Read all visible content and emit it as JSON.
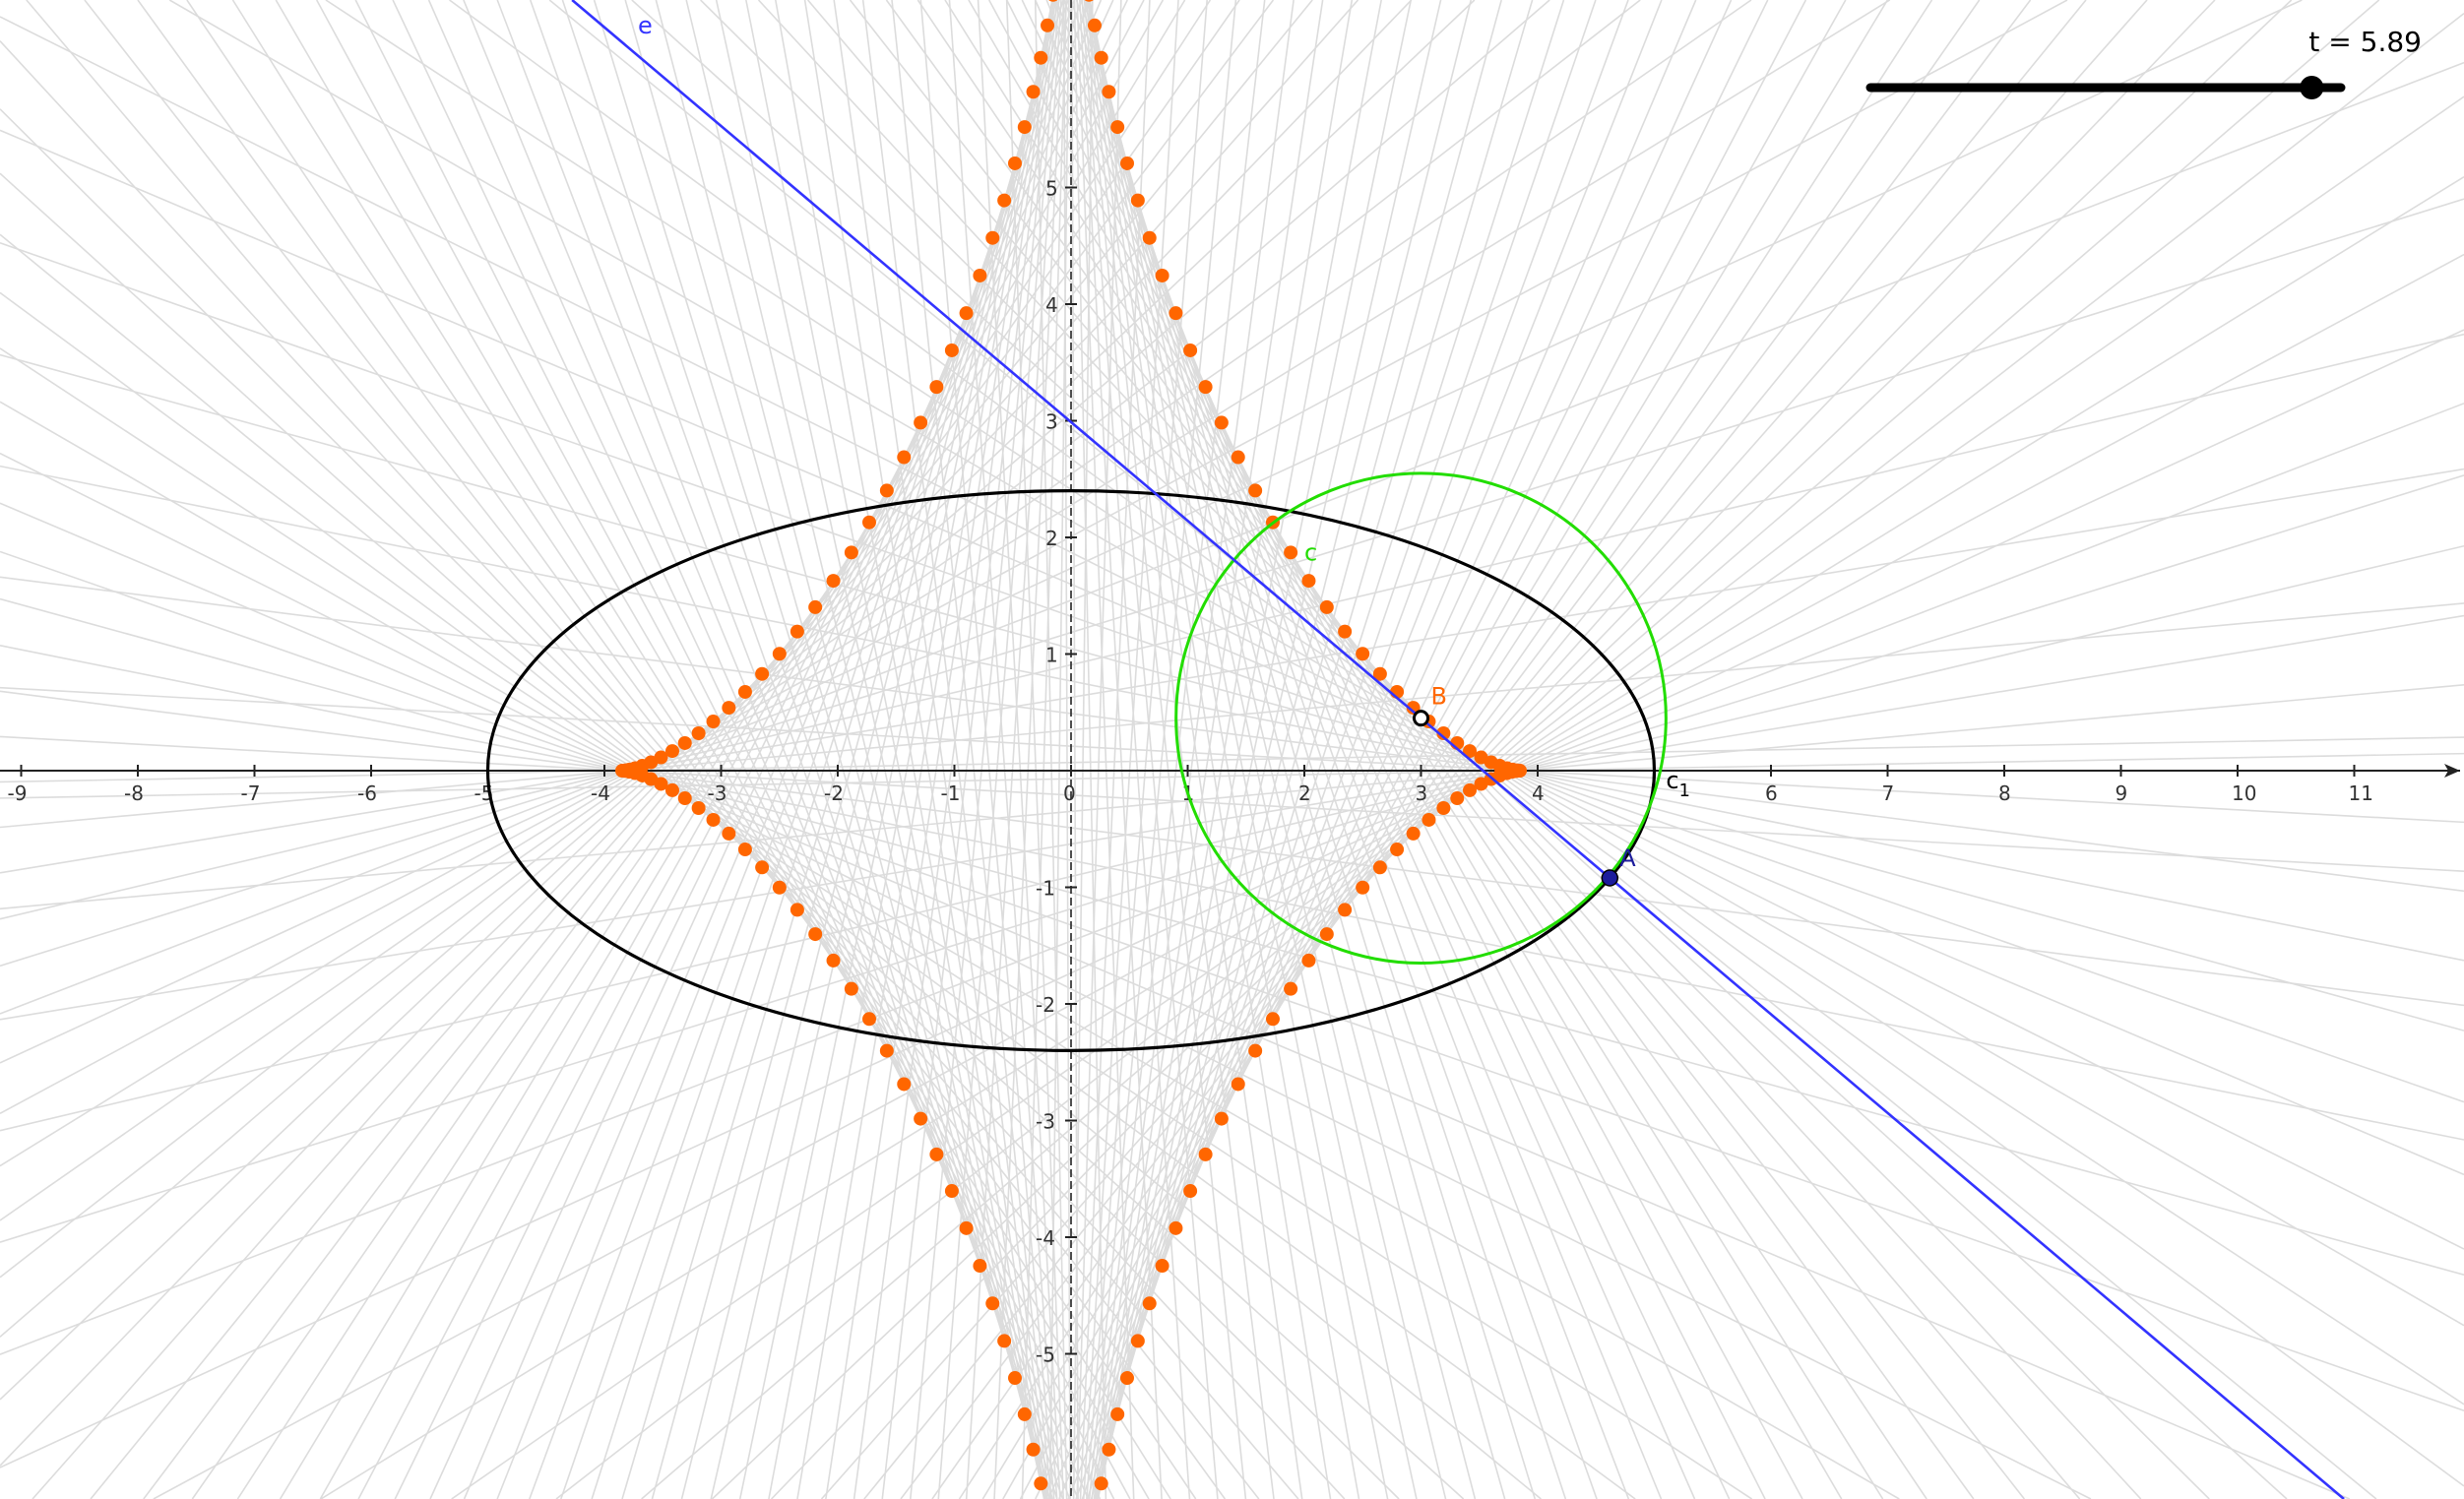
{
  "slider": {
    "name": "t",
    "caption": "t = 5.89",
    "value": 5.89,
    "min": 0,
    "max": 6.28
  },
  "axes": {
    "x_ticks": [
      "-9",
      "-8",
      "-7",
      "-6",
      "-5",
      "-4",
      "-3",
      "-2",
      "-1",
      "0",
      "1",
      "2",
      "3",
      "4",
      "5",
      "6",
      "7",
      "8",
      "9",
      "10",
      "11"
    ],
    "y_ticks": [
      "-5",
      "-4",
      "-3",
      "-2",
      "-1",
      "1",
      "2",
      "3",
      "4",
      "5"
    ],
    "x_range": [
      -9.2,
      11.9
    ],
    "y_range": [
      -6.2,
      6.6
    ]
  },
  "objects": {
    "ellipse": {
      "label": "c1",
      "label_main": "c",
      "label_sub": "1",
      "a": 5,
      "b": 2.4,
      "color": "#000000"
    },
    "circle": {
      "label": "c",
      "center": [
        3,
        0.45
      ],
      "radius": 2.1,
      "color": "#22dd00"
    },
    "line": {
      "label": "e",
      "color": "#3333ff"
    },
    "point_a": {
      "label": "A",
      "color": "#1c1c9c"
    },
    "point_b": {
      "label": "B",
      "color": "#ff6600"
    },
    "locus": {
      "color": "#ff6600",
      "point_count": 180
    },
    "normal_lines": {
      "color": "#dcdcdc",
      "count": 180
    }
  }
}
